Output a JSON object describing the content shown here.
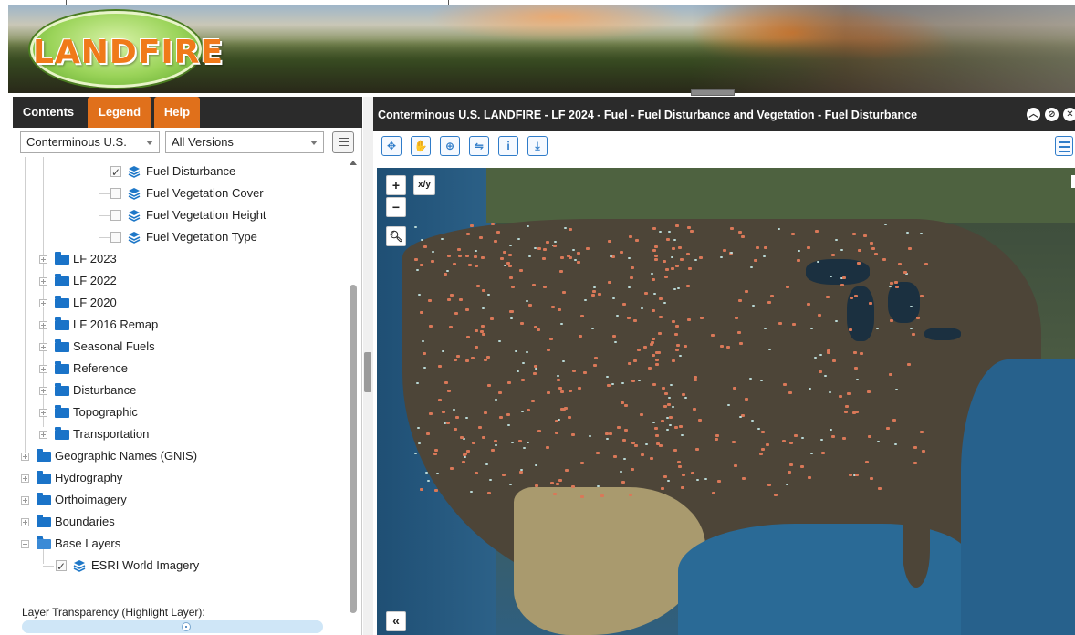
{
  "banner": {
    "logo_text": "LANDFIRE"
  },
  "left_panel": {
    "tabs": [
      {
        "label": "Contents",
        "active": true
      },
      {
        "label": "Legend",
        "active": false
      },
      {
        "label": "Help",
        "active": false
      }
    ],
    "region_select": {
      "value": "Conterminous U.S."
    },
    "version_select": {
      "value": "All Versions"
    },
    "tree": [
      {
        "label": "Fuel Disturbance",
        "type": "layer",
        "checked": true
      },
      {
        "label": "Fuel Vegetation Cover",
        "type": "layer",
        "checked": false
      },
      {
        "label": "Fuel Vegetation Height",
        "type": "layer",
        "checked": false
      },
      {
        "label": "Fuel Vegetation Type",
        "type": "layer",
        "checked": false
      },
      {
        "label": "LF 2023",
        "type": "folder"
      },
      {
        "label": "LF 2022",
        "type": "folder"
      },
      {
        "label": "LF 2020",
        "type": "folder"
      },
      {
        "label": "LF 2016 Remap",
        "type": "folder"
      },
      {
        "label": "Seasonal Fuels",
        "type": "folder"
      },
      {
        "label": "Reference",
        "type": "folder"
      },
      {
        "label": "Disturbance",
        "type": "folder"
      },
      {
        "label": "Topographic",
        "type": "folder"
      },
      {
        "label": "Transportation",
        "type": "folder"
      },
      {
        "label": "Geographic Names (GNIS)",
        "type": "folder"
      },
      {
        "label": "Hydrography",
        "type": "folder"
      },
      {
        "label": "Orthoimagery",
        "type": "folder"
      },
      {
        "label": "Boundaries",
        "type": "folder"
      },
      {
        "label": "Base Layers",
        "type": "folder",
        "expanded": true
      },
      {
        "label": "ESRI World Imagery",
        "type": "layer",
        "checked": true
      }
    ],
    "transparency_label": "Layer Transparency (Highlight Layer):",
    "transparency_value": 0.55
  },
  "map_panel": {
    "title": "Conterminous U.S. LANDFIRE - LF 2024 - Fuel - Fuel Disturbance and Vegetation - Fuel Disturbance",
    "window_buttons": [
      "collapse-icon",
      "minimize-icon",
      "close-icon"
    ],
    "tools": [
      "full-extent-icon",
      "pan-icon",
      "zoom-in-icon",
      "swipe-icon",
      "identify-icon",
      "download-icon"
    ],
    "controls": {
      "zoom_in": "+",
      "zoom_out": "−",
      "xy": "x/y",
      "collapse": "«"
    }
  },
  "colors": {
    "header_bg": "#2b2b2b",
    "tab_accent": "#e0701b",
    "tool_blue": "#2f7cc9",
    "disturbance_orange": "#d97858"
  }
}
